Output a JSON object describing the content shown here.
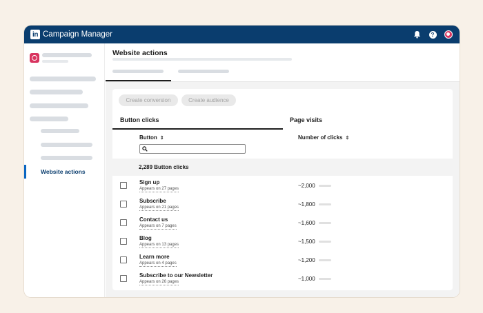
{
  "app": {
    "title": "Campaign Manager",
    "logo_text": "in"
  },
  "topbar_icons": [
    "bell-icon",
    "help-icon",
    "avatar"
  ],
  "topbar_help_glyph": "?",
  "sidebar": {
    "active_item": "Website actions"
  },
  "page": {
    "title": "Website actions"
  },
  "actions": {
    "create_conversion": "Create conversion",
    "create_audience": "Create audience"
  },
  "section_tabs": {
    "button_clicks": "Button clicks",
    "page_visits": "Page visits"
  },
  "table": {
    "col_button": "Button",
    "col_clicks": "Number of clicks",
    "sort_glyph": "⇕",
    "search_placeholder": "",
    "summary": "2,289 Button clicks",
    "rows": [
      {
        "title": "Sign up",
        "sub": "Appears on 27 pages",
        "count": "~2,000"
      },
      {
        "title": "Subscribe",
        "sub": "Appears on 21 pages",
        "count": "~1,800"
      },
      {
        "title": "Contact us",
        "sub": "Appears on 7 pages",
        "count": "~1,600"
      },
      {
        "title": "Blog",
        "sub": "Appears on 13 pages",
        "count": "~1,500"
      },
      {
        "title": "Learn more",
        "sub": "Appears on 4 pages",
        "count": "~1,200"
      },
      {
        "title": "Subscribe to our Newsletter",
        "sub": "Appears on 26 pages",
        "count": "~1,000"
      }
    ]
  },
  "colors": {
    "topbar": "#0a3d6e",
    "accent": "#0a66c2",
    "brand_avatar": "#d8345f",
    "background": "#f8f1e8"
  }
}
